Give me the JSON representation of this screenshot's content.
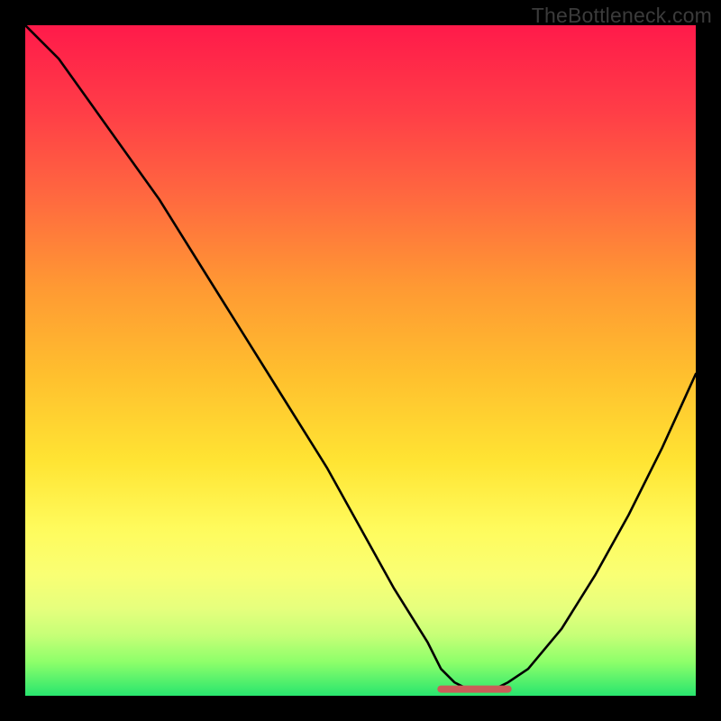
{
  "watermark": "TheBottleneck.com",
  "chart_data": {
    "type": "line",
    "title": "",
    "xlabel": "",
    "ylabel": "",
    "xlim": [
      0,
      100
    ],
    "ylim": [
      0,
      100
    ],
    "series": [
      {
        "name": "curve",
        "x": [
          0,
          5,
          10,
          15,
          20,
          25,
          30,
          35,
          40,
          45,
          50,
          55,
          60,
          62,
          64,
          66,
          68,
          70,
          72,
          75,
          80,
          85,
          90,
          95,
          100
        ],
        "values": [
          100,
          95,
          88,
          81,
          74,
          66,
          58,
          50,
          42,
          34,
          25,
          16,
          8,
          4,
          2,
          1,
          1,
          1,
          2,
          4,
          10,
          18,
          27,
          37,
          48
        ]
      },
      {
        "name": "flat-marker",
        "x": [
          62,
          72
        ],
        "values": [
          1,
          1
        ]
      }
    ],
    "gradient_stops": [
      {
        "pos": 0,
        "color": "#ff1a4a"
      },
      {
        "pos": 13,
        "color": "#ff3e47"
      },
      {
        "pos": 26,
        "color": "#ff6a3f"
      },
      {
        "pos": 39,
        "color": "#ff9933"
      },
      {
        "pos": 52,
        "color": "#ffbf2e"
      },
      {
        "pos": 65,
        "color": "#ffe433"
      },
      {
        "pos": 75,
        "color": "#fffb5c"
      },
      {
        "pos": 82,
        "color": "#f9ff74"
      },
      {
        "pos": 87,
        "color": "#e6ff7d"
      },
      {
        "pos": 91,
        "color": "#c6ff77"
      },
      {
        "pos": 95,
        "color": "#8dff6a"
      },
      {
        "pos": 100,
        "color": "#28e56e"
      }
    ],
    "marker_color": "#cb5c58"
  }
}
